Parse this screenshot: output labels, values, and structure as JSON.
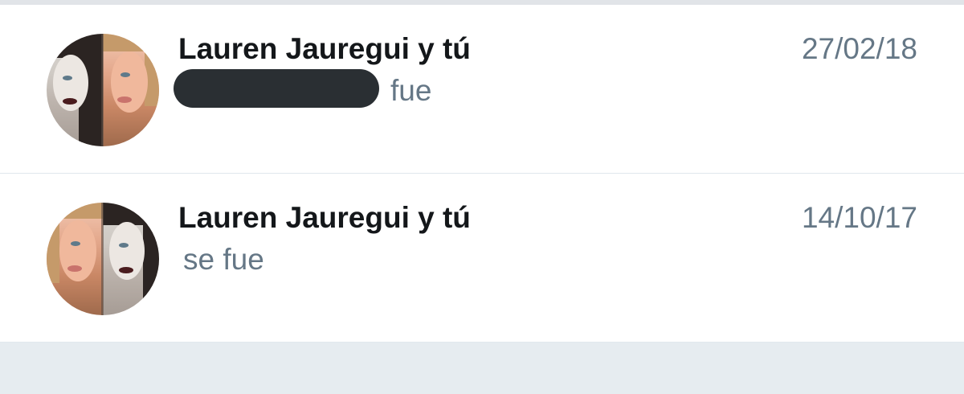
{
  "conversations": [
    {
      "name": "Lauren Jauregui y tú",
      "date": "27/02/18",
      "snippet": "fue"
    },
    {
      "name": "Lauren Jauregui y tú",
      "date": "14/10/17",
      "snippet": "se fue"
    }
  ],
  "colors": {
    "name_text": "#14171a",
    "secondary_text": "#657786",
    "divider": "#e1e8ed",
    "footer_background": "#e6ecf0",
    "redaction": "#2a2f33"
  },
  "icons": {
    "avatar": "group-avatar"
  }
}
